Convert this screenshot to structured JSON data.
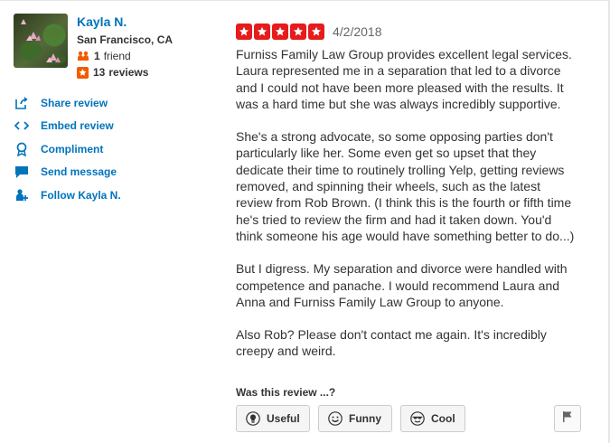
{
  "user": {
    "name": "Kayla N.",
    "location": "San Francisco, CA",
    "friends_count": "1",
    "friends_label": "friend",
    "reviews_count": "13",
    "reviews_label": "reviews"
  },
  "actions": [
    {
      "label": "Share review",
      "icon": "share-icon"
    },
    {
      "label": "Embed review",
      "icon": "embed-icon"
    },
    {
      "label": "Compliment",
      "icon": "compliment-icon"
    },
    {
      "label": "Send message",
      "icon": "message-icon"
    },
    {
      "label": "Follow Kayla N.",
      "icon": "follow-icon"
    }
  ],
  "review": {
    "rating": 5,
    "max_rating": 5,
    "date": "4/2/2018",
    "paragraphs": [
      "Furniss Family Law Group provides excellent legal services. Laura represented me in a separation that led to a divorce and I could not have been more pleased with the results. It was a hard time but she was always incredibly supportive.",
      "She's a strong advocate, so some opposing parties don't particularly like her. Some even get so upset that they dedicate their time to routinely trolling Yelp, getting reviews removed, and spinning their wheels, such as the latest review from Rob Brown. (I think this is the fourth or fifth time he's tried to review the firm and had it taken down. You'd think someone his age would have something better to do...)",
      "But I digress. My separation and divorce were handled with competence and panache. I would recommend Laura and Anna and Furniss Family Law Group to anyone.",
      "Also Rob? Please don't contact me again. It's incredibly creepy and weird."
    ]
  },
  "feedback": {
    "title": "Was this review ...?",
    "useful": "Useful",
    "funny": "Funny",
    "cool": "Cool"
  },
  "colors": {
    "link": "#0073bb",
    "star": "#e61c1c",
    "friend_icon": "#f15c00"
  }
}
